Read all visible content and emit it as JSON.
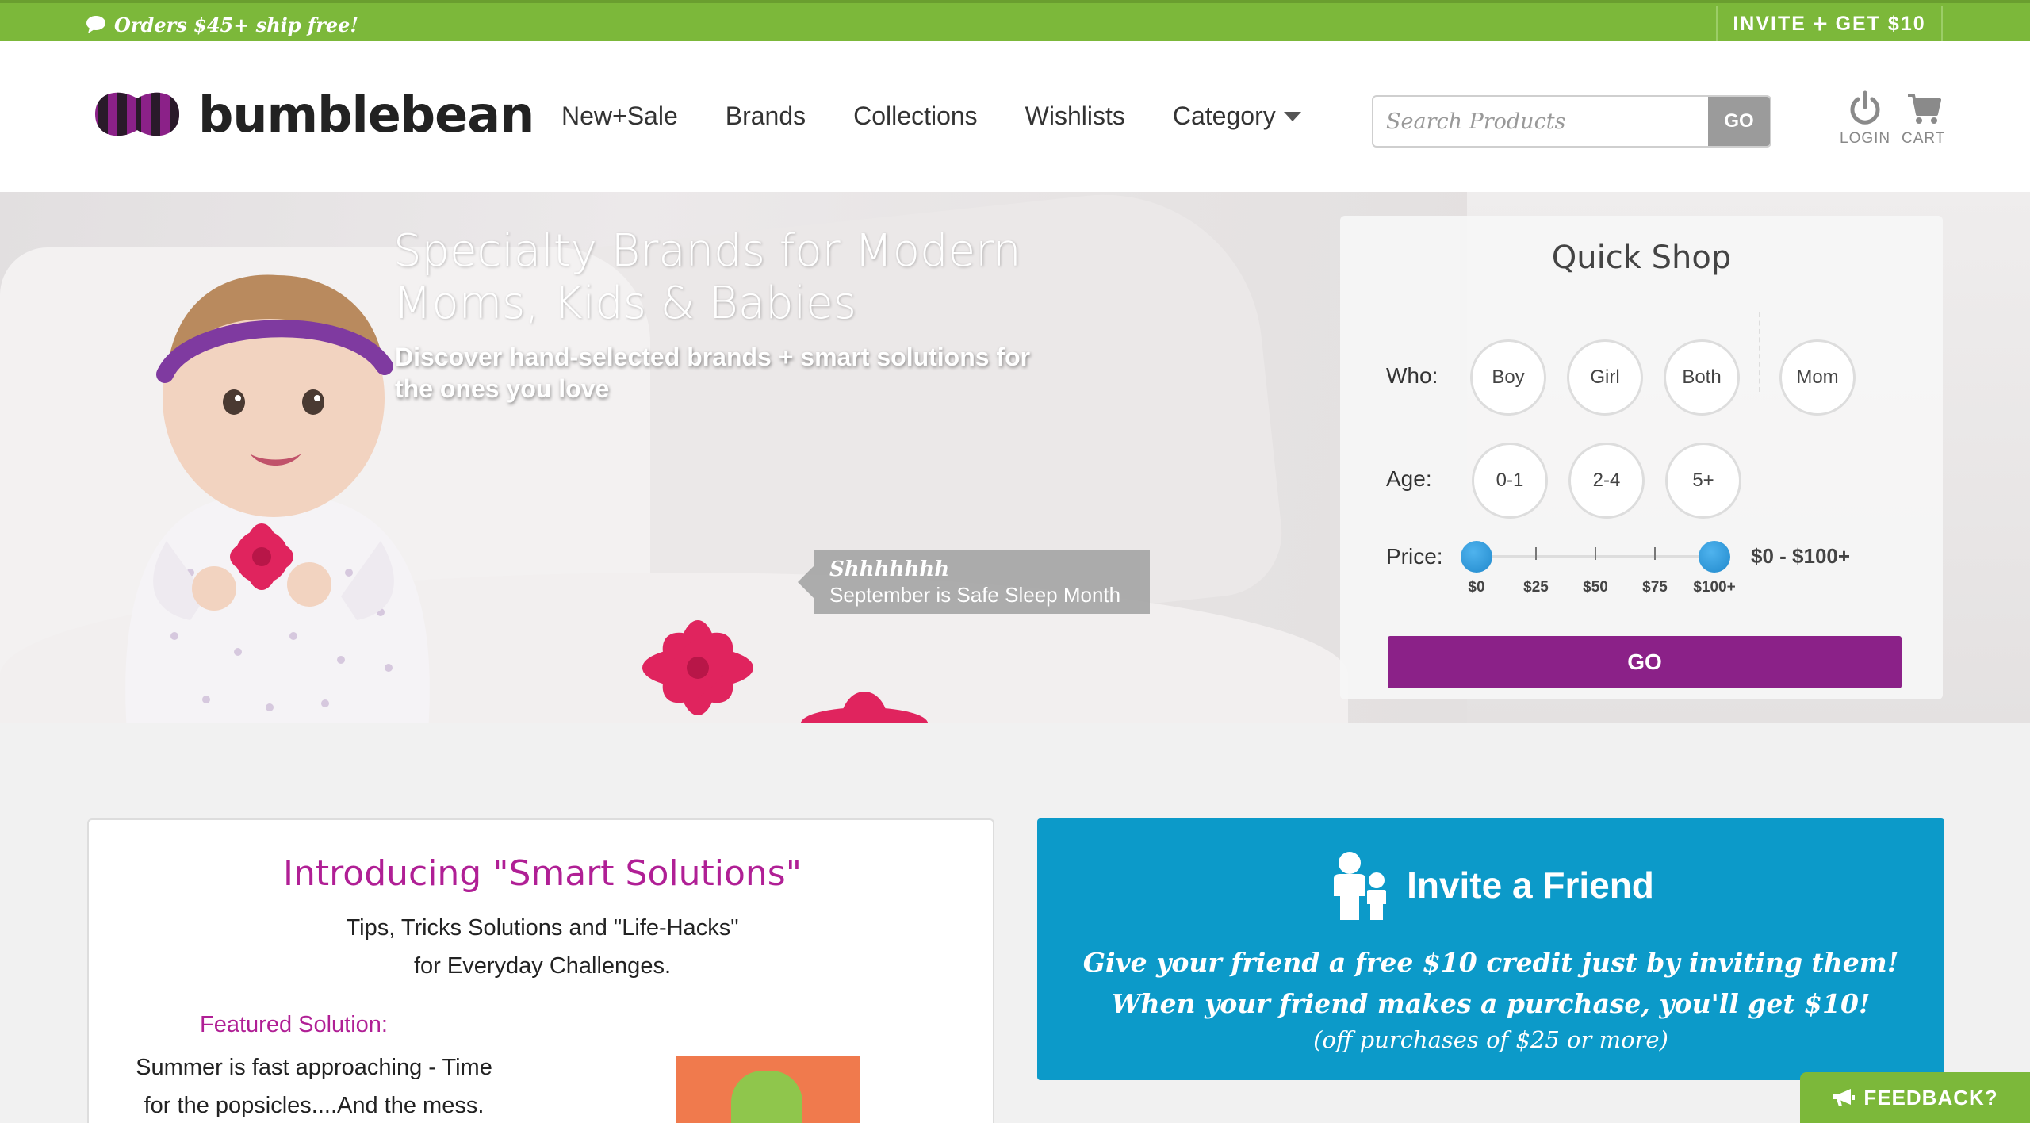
{
  "topbar": {
    "promo_text": "Orders $45+ ship free!",
    "invite_left": "INVITE",
    "invite_plus": "+",
    "invite_right": "GET $10"
  },
  "header": {
    "logo_text": "bumblebean",
    "nav": [
      "New+Sale",
      "Brands",
      "Collections",
      "Wishlists",
      "Category"
    ],
    "search_placeholder": "Search Products",
    "search_go": "GO",
    "login_label": "LOGIN",
    "cart_label": "CART"
  },
  "hero": {
    "title": "Specialty Brands for Modern Moms, Kids & Babies",
    "subtitle": "Discover hand-selected brands + smart solutions for the ones you love",
    "caption_title": "Shhhhhhh",
    "caption_text": "September is Safe Sleep Month"
  },
  "quick_shop": {
    "title": "Quick Shop",
    "who_label": "Who:",
    "who_options": [
      "Boy",
      "Girl",
      "Both",
      "Mom"
    ],
    "age_label": "Age:",
    "age_options": [
      "0-1",
      "2-4",
      "5+"
    ],
    "price_label": "Price:",
    "price_ticks": [
      "$0",
      "$25",
      "$50",
      "$75",
      "$100+"
    ],
    "price_range": "$0 - $100+",
    "price_min_fraction": 0,
    "price_max_fraction": 1,
    "go_label": "GO",
    "go_color": "#8b2188"
  },
  "smart_solutions": {
    "title": "Introducing \"Smart Solutions\"",
    "subtitle_line1": "Tips, Tricks Solutions and \"Life-Hacks\"",
    "subtitle_line2": "for Everyday Challenges.",
    "featured_label": "Featured Solution:",
    "featured_line1": "Summer is fast approaching - Time",
    "featured_line2": "for the popsicles....And the mess."
  },
  "invite_card": {
    "title": "Invite a Friend",
    "line1": "Give your friend a free $10 credit just by inviting them!",
    "line2": "When your friend makes a purchase, you'll get $10!",
    "note": "(off purchases of $25 or more)",
    "color": "#0c9ac9"
  },
  "feedback": {
    "label": "FEEDBACK?"
  },
  "colors": {
    "brand_green": "#7cb83a",
    "brand_purple": "#8b2188",
    "accent_magenta": "#b01f95",
    "slider_blue": "#2189cc"
  }
}
